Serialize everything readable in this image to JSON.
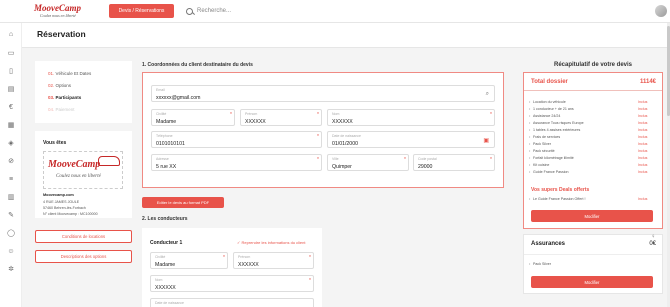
{
  "app": {
    "logo_main": "MooveCamp",
    "logo_sub": "Coulez nous en liberté",
    "nav_button": "Devis / Réservations",
    "search_placeholder": "Recherche..."
  },
  "sidebar_icons": [
    "home-icon",
    "car-icon",
    "document-icon",
    "file-icon",
    "euro-icon",
    "clipboard-icon",
    "tag-icon",
    "ban-icon",
    "list-icon",
    "book-icon",
    "edit-icon",
    "chat-icon",
    "user-icon",
    "settings-icon"
  ],
  "page": {
    "title": "Réservation"
  },
  "steps": [
    {
      "num": "01.",
      "label": "Véhicule Et Dates"
    },
    {
      "num": "02.",
      "label": "Options"
    },
    {
      "num": "03.",
      "label": "Participants"
    },
    {
      "num": "04.",
      "label": "Paiement"
    }
  ],
  "agency": {
    "title": "Vous êtes",
    "logo_main": "MooveCamp",
    "logo_sub": "Coulez nous en liberté",
    "name": "Moovecamp.com",
    "address": "4 RUE JAMES JOULE",
    "city": "57460 Behren-lès-Forbach",
    "client_no": "N° client Moovecamp : MC100000"
  },
  "side_buttons": {
    "conditions": "Conditions de locations",
    "options": "Descriptions des options"
  },
  "client_section": {
    "title": "1. Coordonnées du client destinataire du devis",
    "email": {
      "label": "Email",
      "value": "xxxxxx@gmail.com"
    },
    "civilite": {
      "label": "Civilité",
      "value": "Madame"
    },
    "prenom": {
      "label": "Prénom",
      "value": "XXXXXX"
    },
    "nom": {
      "label": "Nom",
      "value": "XXXXXX"
    },
    "telephone": {
      "label": "Téléphone",
      "value": "0101010101"
    },
    "naissance": {
      "label": "Date de naissance",
      "value": "01/01/2000"
    },
    "adresse": {
      "label": "Adresse",
      "value": "5 rue XX"
    },
    "ville": {
      "label": "Ville",
      "value": "Quimper"
    },
    "cp": {
      "label": "Code postal",
      "value": "29000"
    }
  },
  "pdf_button": "Editer le devis au format PDF",
  "drivers_section": {
    "title": "2. Les conducteurs",
    "conducteur_title": "Conducteur 1",
    "reprendre_link": "✓ Reprendre les informations du client",
    "civilite": {
      "label": "Civilité",
      "value": "Madame"
    },
    "prenom": {
      "label": "Prénom",
      "value": "XXXXXX"
    },
    "nom": {
      "label": "Nom",
      "value": "XXXXXX"
    },
    "naissance": {
      "label": "Date de naissance",
      "value": ""
    }
  },
  "recap": {
    "title": "Récapitulatif de votre devis",
    "total_label": "Total dossier",
    "total_value": "1114€",
    "items": [
      {
        "label": "Location du véhicule",
        "status": "Inclus"
      },
      {
        "label": "1 conducteur + de 21 ans",
        "status": "Inclus"
      },
      {
        "label": "Assistance 24/24",
        "status": "Inclus"
      },
      {
        "label": "Assurance Tous risques Europe",
        "status": "Inclus"
      },
      {
        "label": "1 tables 4 assises extérieures",
        "status": "Inclus"
      },
      {
        "label": "Frais de services",
        "status": "Inclus"
      },
      {
        "label": "Pack Silver",
        "status": "Inclus"
      },
      {
        "label": "Pack sécurité",
        "status": "Inclus"
      },
      {
        "label": "Forfait kilométrage illimité",
        "status": "Inclus"
      },
      {
        "label": "Kit cuisine",
        "status": "Inclus"
      },
      {
        "label": "Guide France Passion",
        "status": "Inclus"
      }
    ],
    "deals_title": "Vos supers Deals offerts",
    "deals": [
      {
        "label": "Le Guide France Passion Offert !",
        "status": "Inclus"
      }
    ],
    "modify_button": "Modifier"
  },
  "assurances": {
    "label": "Assurances",
    "value": "0€",
    "items": [
      "Pack Silver"
    ],
    "modify_button": "Modifier"
  },
  "colors": {
    "accent": "#e8534a",
    "brand": "#c62828"
  }
}
